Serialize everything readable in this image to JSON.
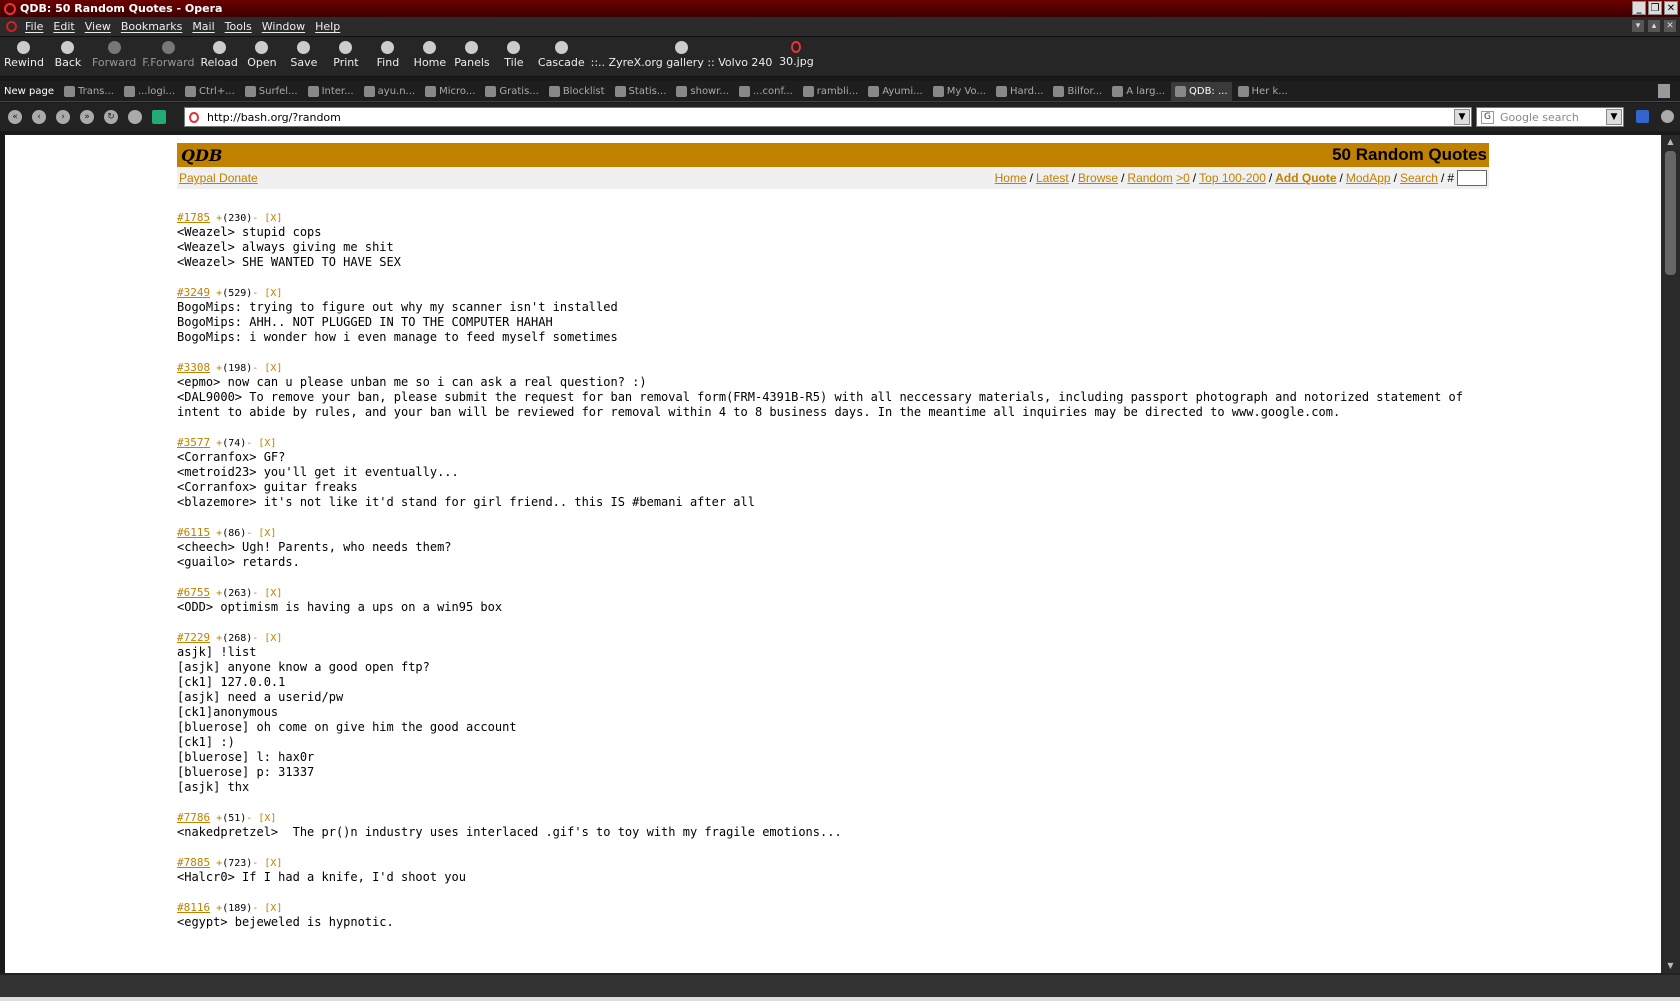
{
  "window": {
    "title": "QDB: 50 Random Quotes - Opera",
    "buttons": [
      "_",
      "❐",
      "✕"
    ]
  },
  "menu": [
    "File",
    "Edit",
    "View",
    "Bookmarks",
    "Mail",
    "Tools",
    "Window",
    "Help"
  ],
  "toolbar": [
    {
      "label": "Rewind",
      "icon": "rewind-icon"
    },
    {
      "label": "Back",
      "icon": "back-icon"
    },
    {
      "label": "Forward",
      "icon": "forward-icon",
      "dim": true
    },
    {
      "label": "F.Forward",
      "icon": "fast-forward-icon",
      "dim": true
    },
    {
      "label": "Reload",
      "icon": "reload-icon"
    },
    {
      "label": "Open",
      "icon": "open-icon"
    },
    {
      "label": "Save",
      "icon": "save-icon"
    },
    {
      "label": "Print",
      "icon": "print-icon"
    },
    {
      "label": "Find",
      "icon": "find-icon"
    },
    {
      "label": "Home",
      "icon": "home-icon"
    },
    {
      "label": "Panels",
      "icon": "panels-icon"
    },
    {
      "label": "Tile",
      "icon": "tile-icon"
    },
    {
      "label": "Cascade",
      "icon": "cascade-icon"
    },
    {
      "label": "::.. ZyreX.org gallery :: Volvo 240",
      "icon": "bookmark-icon"
    },
    {
      "label": "30.jpg",
      "icon": "opera-icon"
    }
  ],
  "tabs": [
    {
      "label": "New page",
      "type": "newpage"
    },
    {
      "label": "Trans..."
    },
    {
      "label": "...logi..."
    },
    {
      "label": "Ctrl+..."
    },
    {
      "label": "Surfel..."
    },
    {
      "label": "Inter..."
    },
    {
      "label": "ayu.n..."
    },
    {
      "label": "Micro..."
    },
    {
      "label": "Gratis..."
    },
    {
      "label": "Blocklist"
    },
    {
      "label": "Statis..."
    },
    {
      "label": "showr..."
    },
    {
      "label": "...conf..."
    },
    {
      "label": "rambli..."
    },
    {
      "label": "Ayumi..."
    },
    {
      "label": "My Vo..."
    },
    {
      "label": "Hard..."
    },
    {
      "label": "Bilfor..."
    },
    {
      "label": "A larg..."
    },
    {
      "label": "QDB: ...",
      "active": true
    },
    {
      "label": "Her k..."
    }
  ],
  "address": {
    "url": "http://bash.org/?random",
    "search_placeholder": "Google search"
  },
  "page": {
    "site": "QDB",
    "heading": "50 Random Quotes",
    "donate": "Paypal Donate",
    "nav": [
      {
        "label": "Home"
      },
      {
        "label": "Latest"
      },
      {
        "label": "Browse"
      },
      {
        "label": "Random"
      },
      {
        "label": ">0",
        "nosep": true
      },
      {
        "label": "Top 100-200"
      },
      {
        "label": "Add Quote",
        "bold": true
      },
      {
        "label": "ModApp"
      },
      {
        "label": "Search"
      }
    ],
    "hash": "#",
    "quotes": [
      {
        "id": "#1785",
        "score": "(230)",
        "lines": [
          "<Weazel> stupid cops",
          "<Weazel> always giving me shit",
          "<Weazel> SHE WANTED TO HAVE SEX"
        ]
      },
      {
        "id": "#3249",
        "score": "(529)",
        "lines": [
          "BogoMips: trying to figure out why my scanner isn't installed",
          "BogoMips: AHH.. NOT PLUGGED IN TO THE COMPUTER HAHAH",
          "BogoMips: i wonder how i even manage to feed myself sometimes"
        ]
      },
      {
        "id": "#3308",
        "score": "(198)",
        "lines": [
          "<epmo> now can u please unban me so i can ask a real question? :)",
          "<DAL9000> To remove your ban, please submit the request for ban removal form(FRM-4391B-R5) with all neccessary materials, including passport photograph and notorized statement of intent to abide by rules, and your ban will be reviewed for removal within 4 to 8 business days. In the meantime all inquiries may be directed to www.google.com."
        ]
      },
      {
        "id": "#3577",
        "score": "(74)",
        "lines": [
          "<Corranfox> GF?",
          "<metroid23> you'll get it eventually...",
          "<Corranfox> guitar freaks",
          "<blazemore> it's not like it'd stand for girl friend.. this IS #bemani after all"
        ]
      },
      {
        "id": "#6115",
        "score": "(86)",
        "lines": [
          "<cheech> Ugh! Parents, who needs them?",
          "<guailo> retards."
        ]
      },
      {
        "id": "#6755",
        "score": "(263)",
        "lines": [
          "<ODD> optimism is having a ups on a win95 box"
        ]
      },
      {
        "id": "#7229",
        "score": "(268)",
        "lines": [
          "asjk] !list",
          "[asjk] anyone know a good open ftp?",
          "[ck1] 127.0.0.1",
          "[asjk] need a userid/pw",
          "[ck1]anonymous",
          "[bluerose] oh come on give him the good account",
          "[ck1] :)",
          "[bluerose] l: hax0r",
          "[bluerose] p: 31337",
          "[asjk] thx"
        ]
      },
      {
        "id": "#7786",
        "score": "(51)",
        "lines": [
          "<nakedpretzel>  The pr()n industry uses interlaced .gif's to toy with my fragile emotions..."
        ]
      },
      {
        "id": "#7885",
        "score": "(723)",
        "lines": [
          "<Halcr0> If I had a knife, I'd shoot you"
        ]
      },
      {
        "id": "#8116",
        "score": "(189)",
        "lines": [
          "<egypt> bejeweled is hypnotic."
        ]
      }
    ],
    "plus": "+",
    "minus": "-",
    "remove": "[X]"
  }
}
